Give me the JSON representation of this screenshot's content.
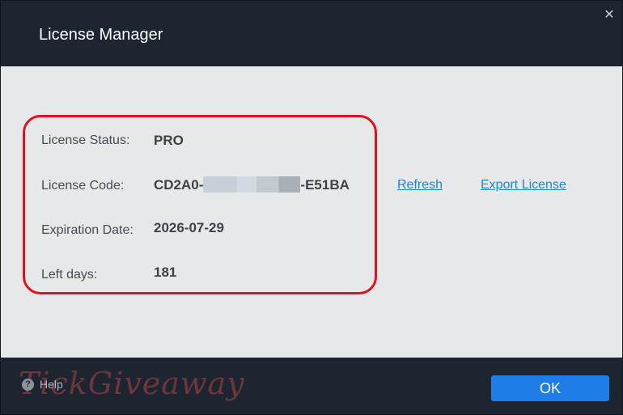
{
  "window": {
    "title": "License Manager",
    "close_icon": "close-icon"
  },
  "license": {
    "status_label": "License Status:",
    "status_value": "PRO",
    "code_label": "License Code:",
    "code_prefix": "CD2A0-",
    "code_suffix": "-E51BA",
    "expiration_label": "Expiration Date:",
    "expiration_value": "2026-07-29",
    "left_days_label": "Left days:",
    "left_days_value": "181"
  },
  "actions": {
    "refresh_label": "Refresh",
    "export_label": "Export License"
  },
  "footer": {
    "help_icon": "question-icon",
    "help_label": "Help",
    "ok_label": "OK",
    "watermark": "TickGiveaway"
  },
  "colors": {
    "titlebar_bg": "#1d2531",
    "content_bg": "#e6e8ea",
    "highlight_border": "#e0121c",
    "link": "#1b86d8",
    "ok_button": "#1f7de8"
  }
}
